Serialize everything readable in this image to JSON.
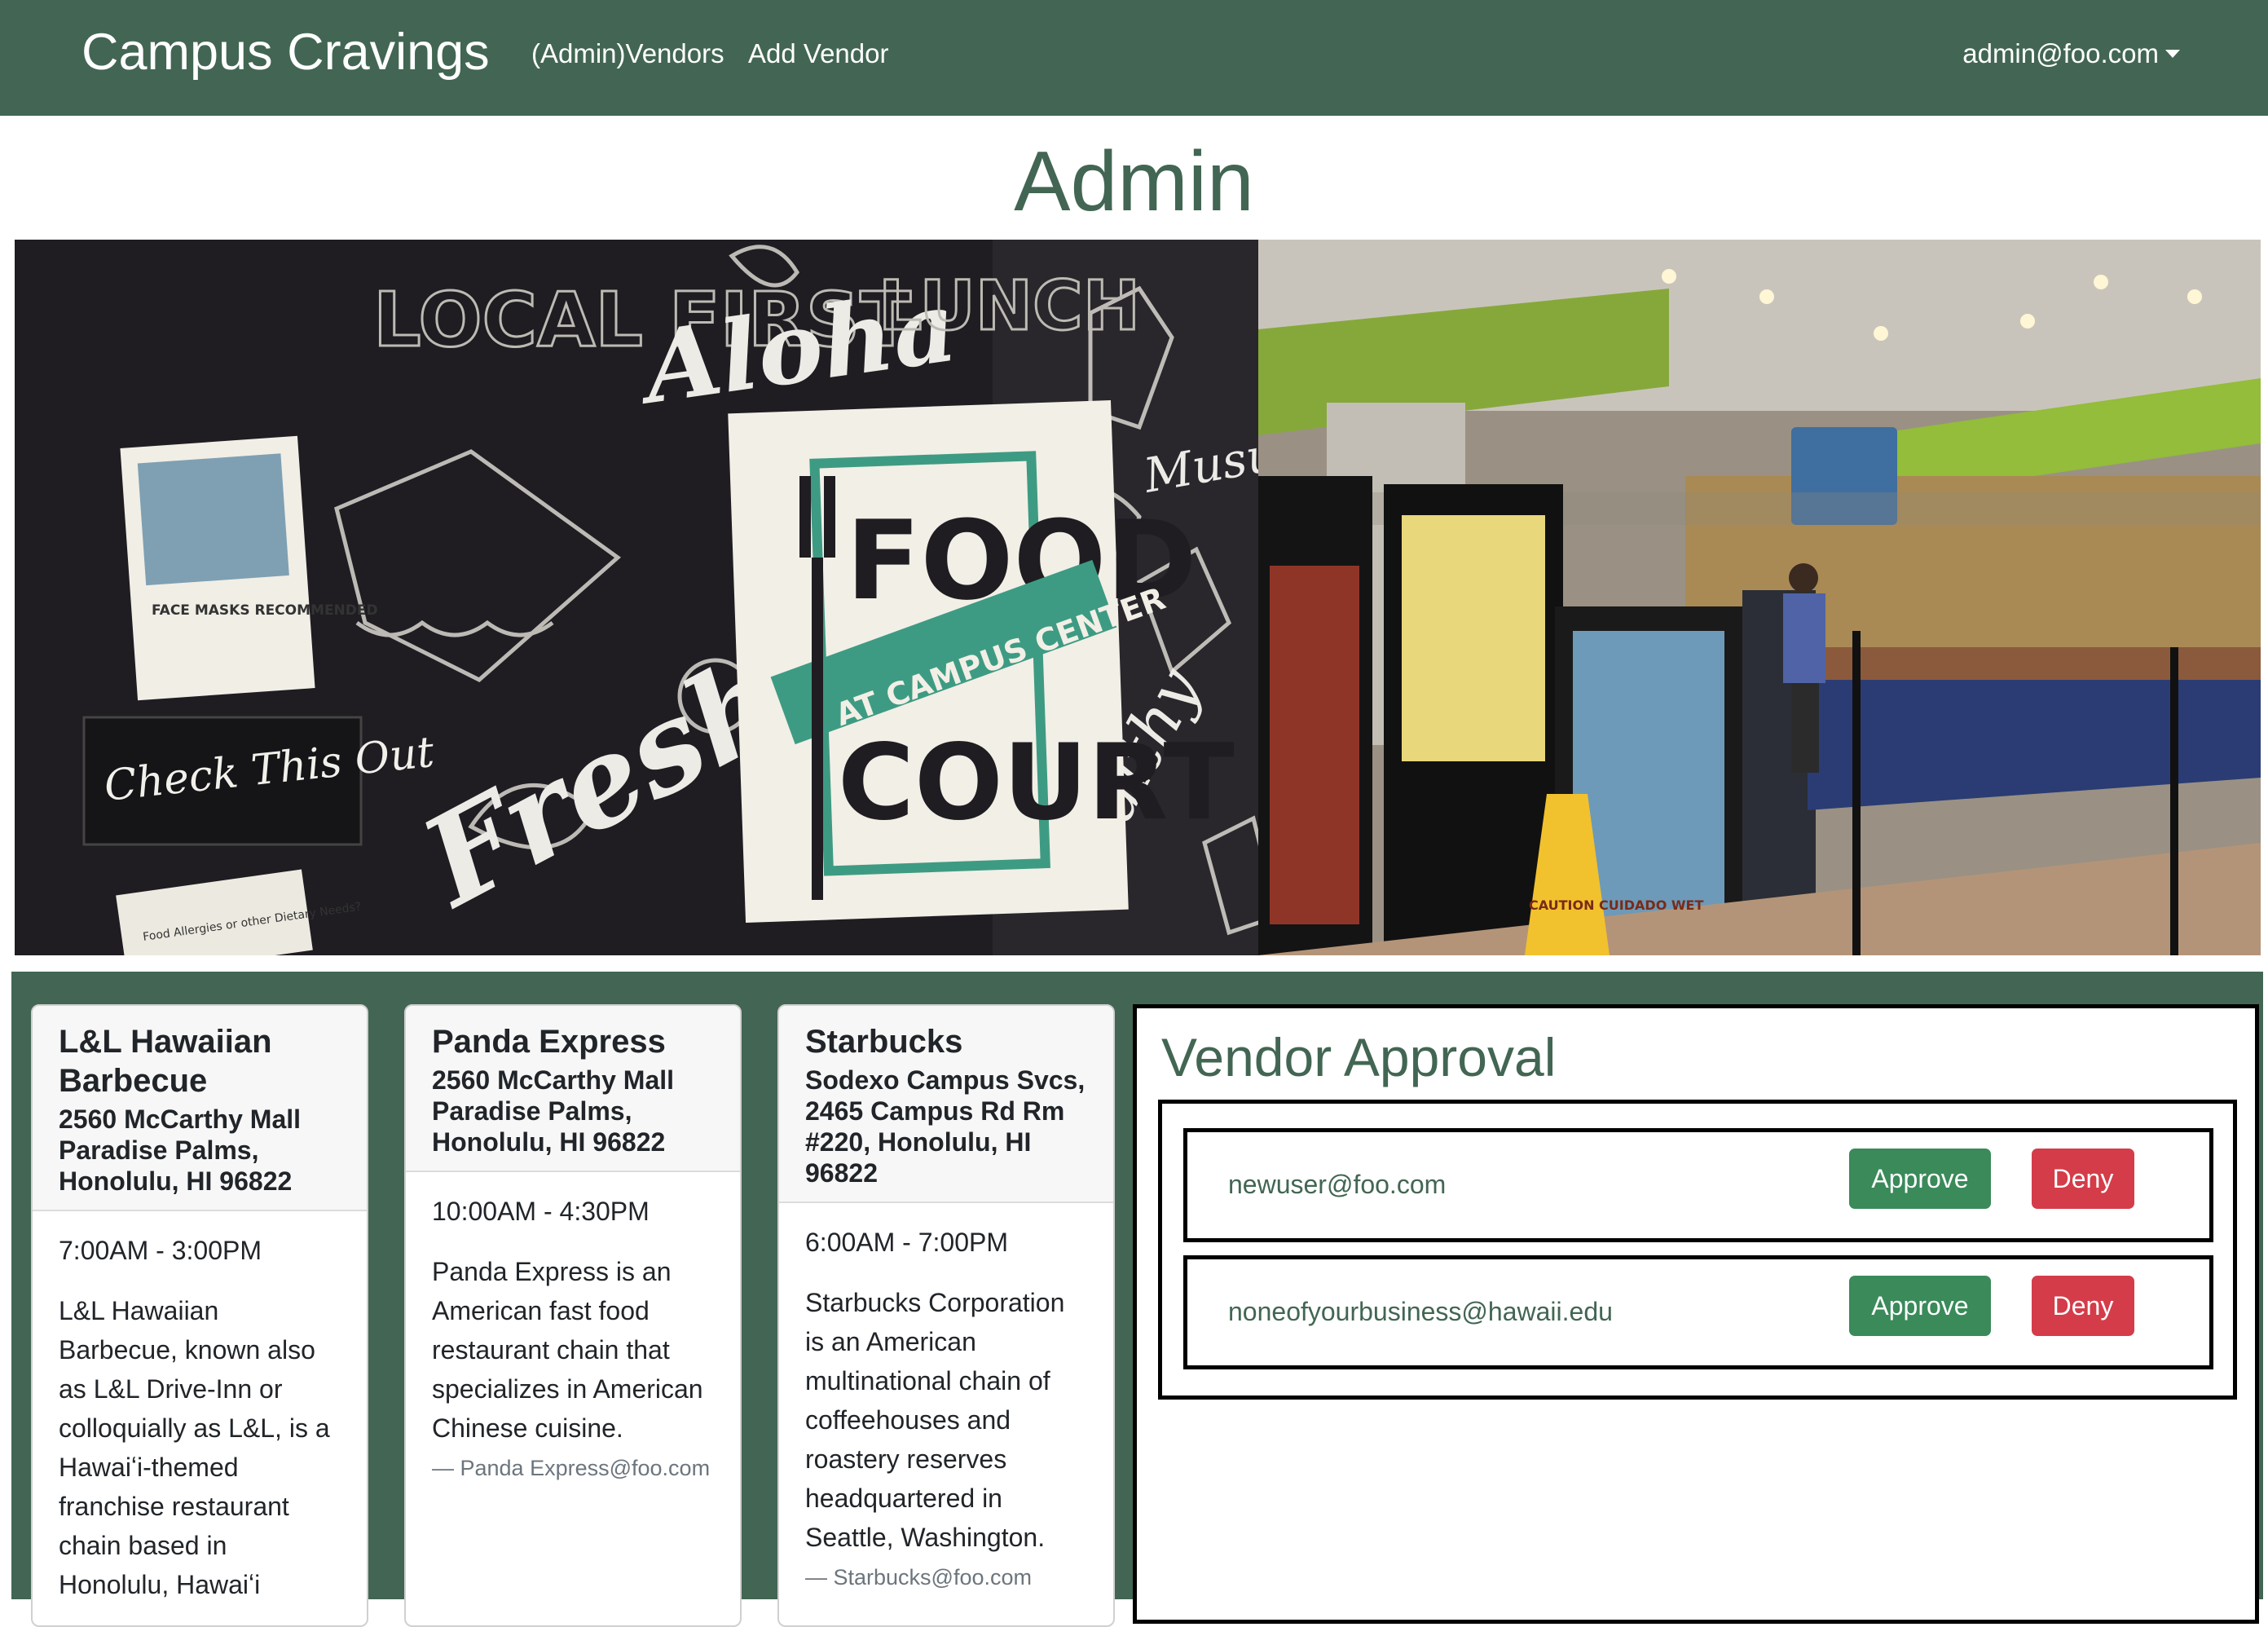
{
  "navbar": {
    "brand": "Campus Cravings",
    "links": [
      "(Admin)Vendors",
      "Add Vendor"
    ],
    "user": "admin@foo.com"
  },
  "page": {
    "title": "Admin"
  },
  "hero": {
    "wall_texts": [
      "LOCAL FIRST",
      "Aloha",
      "LUNCH",
      "Musubi",
      "Fresh",
      "Healthy",
      "Check This Out"
    ],
    "sign": {
      "line1": "FOOD",
      "banner": "AT CAMPUS CENTER",
      "line2": "COURT"
    },
    "poster": "FACE MASKS RECOMMENDED",
    "note": "Food Allergies or other Dietary Needs?",
    "wet_sign": "CAUTION CUIDADO WET"
  },
  "vendors": [
    {
      "name": "L&L Hawaiian Barbecue",
      "address": "2560 McCarthy Mall Paradise Palms, Honolulu, HI 96822",
      "hours": "7:00AM - 3:00PM",
      "description": "L&L Hawaiian Barbecue, known also as L&L Drive-Inn or colloquially as L&L, is a Hawaiʻi-themed franchise restaurant chain based in Honolulu, Hawaiʻi",
      "owner": ""
    },
    {
      "name": "Panda Express",
      "address": "2560 McCarthy Mall Paradise Palms, Honolulu, HI 96822",
      "hours": "10:00AM - 4:30PM",
      "description": "Panda Express is an American fast food restaurant chain that specializes in American Chinese cuisine.",
      "owner": "— Panda Express@foo.com"
    },
    {
      "name": "Starbucks",
      "address": "Sodexo Campus Svcs, 2465 Campus Rd Rm #220, Honolulu, HI 96822",
      "hours": "6:00AM - 7:00PM",
      "description": "Starbucks Corporation is an American multinational chain of coffeehouses and roastery reserves headquartered in Seattle, Washington.",
      "owner": "— Starbucks@foo.com"
    }
  ],
  "approval": {
    "title": "Vendor Approval",
    "approve_label": "Approve",
    "deny_label": "Deny",
    "requests": [
      {
        "email": "newuser@foo.com"
      },
      {
        "email": "noneofyourbusiness@hawaii.edu"
      }
    ]
  },
  "colors": {
    "primary": "#426653",
    "approve": "#3a8a5a",
    "deny": "#d43c49"
  }
}
